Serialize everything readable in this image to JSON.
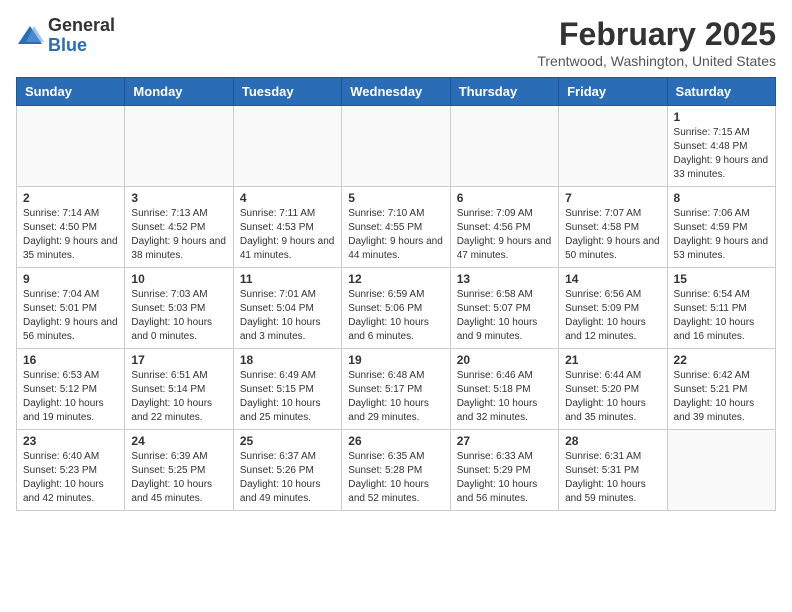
{
  "header": {
    "logo_general": "General",
    "logo_blue": "Blue",
    "month_title": "February 2025",
    "location": "Trentwood, Washington, United States"
  },
  "days_of_week": [
    "Sunday",
    "Monday",
    "Tuesday",
    "Wednesday",
    "Thursday",
    "Friday",
    "Saturday"
  ],
  "weeks": [
    [
      {
        "day": "",
        "info": ""
      },
      {
        "day": "",
        "info": ""
      },
      {
        "day": "",
        "info": ""
      },
      {
        "day": "",
        "info": ""
      },
      {
        "day": "",
        "info": ""
      },
      {
        "day": "",
        "info": ""
      },
      {
        "day": "1",
        "info": "Sunrise: 7:15 AM\nSunset: 4:48 PM\nDaylight: 9 hours and 33 minutes."
      }
    ],
    [
      {
        "day": "2",
        "info": "Sunrise: 7:14 AM\nSunset: 4:50 PM\nDaylight: 9 hours and 35 minutes."
      },
      {
        "day": "3",
        "info": "Sunrise: 7:13 AM\nSunset: 4:52 PM\nDaylight: 9 hours and 38 minutes."
      },
      {
        "day": "4",
        "info": "Sunrise: 7:11 AM\nSunset: 4:53 PM\nDaylight: 9 hours and 41 minutes."
      },
      {
        "day": "5",
        "info": "Sunrise: 7:10 AM\nSunset: 4:55 PM\nDaylight: 9 hours and 44 minutes."
      },
      {
        "day": "6",
        "info": "Sunrise: 7:09 AM\nSunset: 4:56 PM\nDaylight: 9 hours and 47 minutes."
      },
      {
        "day": "7",
        "info": "Sunrise: 7:07 AM\nSunset: 4:58 PM\nDaylight: 9 hours and 50 minutes."
      },
      {
        "day": "8",
        "info": "Sunrise: 7:06 AM\nSunset: 4:59 PM\nDaylight: 9 hours and 53 minutes."
      }
    ],
    [
      {
        "day": "9",
        "info": "Sunrise: 7:04 AM\nSunset: 5:01 PM\nDaylight: 9 hours and 56 minutes."
      },
      {
        "day": "10",
        "info": "Sunrise: 7:03 AM\nSunset: 5:03 PM\nDaylight: 10 hours and 0 minutes."
      },
      {
        "day": "11",
        "info": "Sunrise: 7:01 AM\nSunset: 5:04 PM\nDaylight: 10 hours and 3 minutes."
      },
      {
        "day": "12",
        "info": "Sunrise: 6:59 AM\nSunset: 5:06 PM\nDaylight: 10 hours and 6 minutes."
      },
      {
        "day": "13",
        "info": "Sunrise: 6:58 AM\nSunset: 5:07 PM\nDaylight: 10 hours and 9 minutes."
      },
      {
        "day": "14",
        "info": "Sunrise: 6:56 AM\nSunset: 5:09 PM\nDaylight: 10 hours and 12 minutes."
      },
      {
        "day": "15",
        "info": "Sunrise: 6:54 AM\nSunset: 5:11 PM\nDaylight: 10 hours and 16 minutes."
      }
    ],
    [
      {
        "day": "16",
        "info": "Sunrise: 6:53 AM\nSunset: 5:12 PM\nDaylight: 10 hours and 19 minutes."
      },
      {
        "day": "17",
        "info": "Sunrise: 6:51 AM\nSunset: 5:14 PM\nDaylight: 10 hours and 22 minutes."
      },
      {
        "day": "18",
        "info": "Sunrise: 6:49 AM\nSunset: 5:15 PM\nDaylight: 10 hours and 25 minutes."
      },
      {
        "day": "19",
        "info": "Sunrise: 6:48 AM\nSunset: 5:17 PM\nDaylight: 10 hours and 29 minutes."
      },
      {
        "day": "20",
        "info": "Sunrise: 6:46 AM\nSunset: 5:18 PM\nDaylight: 10 hours and 32 minutes."
      },
      {
        "day": "21",
        "info": "Sunrise: 6:44 AM\nSunset: 5:20 PM\nDaylight: 10 hours and 35 minutes."
      },
      {
        "day": "22",
        "info": "Sunrise: 6:42 AM\nSunset: 5:21 PM\nDaylight: 10 hours and 39 minutes."
      }
    ],
    [
      {
        "day": "23",
        "info": "Sunrise: 6:40 AM\nSunset: 5:23 PM\nDaylight: 10 hours and 42 minutes."
      },
      {
        "day": "24",
        "info": "Sunrise: 6:39 AM\nSunset: 5:25 PM\nDaylight: 10 hours and 45 minutes."
      },
      {
        "day": "25",
        "info": "Sunrise: 6:37 AM\nSunset: 5:26 PM\nDaylight: 10 hours and 49 minutes."
      },
      {
        "day": "26",
        "info": "Sunrise: 6:35 AM\nSunset: 5:28 PM\nDaylight: 10 hours and 52 minutes."
      },
      {
        "day": "27",
        "info": "Sunrise: 6:33 AM\nSunset: 5:29 PM\nDaylight: 10 hours and 56 minutes."
      },
      {
        "day": "28",
        "info": "Sunrise: 6:31 AM\nSunset: 5:31 PM\nDaylight: 10 hours and 59 minutes."
      },
      {
        "day": "",
        "info": ""
      }
    ]
  ]
}
